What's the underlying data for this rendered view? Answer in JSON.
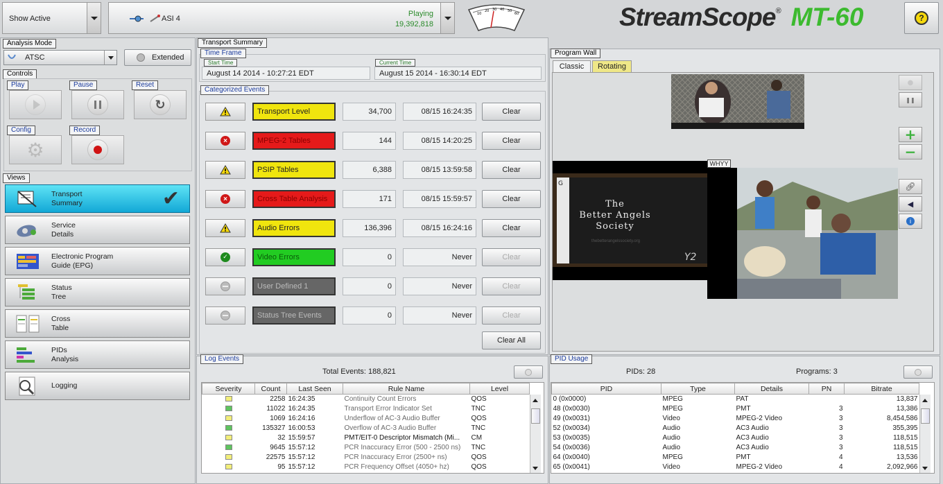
{
  "header": {
    "analysis_dropdown": "Show Active",
    "input_icon": "connector-icon",
    "input_name": "ASI 4",
    "status": "Playing",
    "bitrate": "19,392,818",
    "meter_ticks": [
      "10",
      "20",
      "30",
      "40",
      "50",
      "60"
    ],
    "logo_main": "StreamScope",
    "logo_model": "MT-60",
    "help_icon": "help-icon"
  },
  "analysis_mode": {
    "title": "Analysis Mode",
    "value": "ATSC",
    "extended": "Extended"
  },
  "controls": {
    "title": "Controls",
    "play": "Play",
    "pause": "Pause",
    "reset": "Reset",
    "config": "Config",
    "record": "Record"
  },
  "views": {
    "title": "Views",
    "items": [
      {
        "label": "Transport\nSummary",
        "icon": "transport-icon"
      },
      {
        "label": "Service\nDetails",
        "icon": "service-icon"
      },
      {
        "label": "Electronic Program\nGuide (EPG)",
        "icon": "epg-icon"
      },
      {
        "label": "Status\nTree",
        "icon": "tree-icon"
      },
      {
        "label": "Cross\nTable",
        "icon": "table-icon"
      },
      {
        "label": "PIDs\nAnalysis",
        "icon": "pids-icon"
      },
      {
        "label": "Logging",
        "icon": "logging-icon"
      }
    ]
  },
  "transport_summary": {
    "title": "Transport Summary",
    "time_frame": "Time Frame",
    "start_label": "Start Time",
    "start_value": "August 14 2014 - 10:27:21 EDT",
    "current_label": "Current Time",
    "current_value": "August 15 2014 - 16:30:14 EDT",
    "categorized_title": "Categorized Events",
    "clear_all": "Clear All",
    "events": [
      {
        "status": "warning",
        "label": "Transport Level",
        "color": "#f0e50e",
        "text": "#222",
        "count": "34,700",
        "time": "08/15 16:24:35",
        "clear": "Clear"
      },
      {
        "status": "error",
        "label": "MPEG-2 Tables",
        "color": "#e51a1a",
        "text": "#8a0000",
        "count": "144",
        "time": "08/15 14:20:25",
        "clear": "Clear"
      },
      {
        "status": "warning",
        "label": "PSIP Tables",
        "color": "#f0e50e",
        "text": "#222",
        "count": "6,388",
        "time": "08/15 13:59:58",
        "clear": "Clear"
      },
      {
        "status": "error",
        "label": "Cross Table Analysis",
        "color": "#e51a1a",
        "text": "#8a0000",
        "count": "171",
        "time": "08/15 15:59:57",
        "clear": "Clear"
      },
      {
        "status": "warning",
        "label": "Audio Errors",
        "color": "#f0e50e",
        "text": "#222",
        "count": "136,396",
        "time": "08/15 16:24:16",
        "clear": "Clear"
      },
      {
        "status": "ok",
        "label": "Video Errors",
        "color": "#22cc22",
        "text": "#0a5a0a",
        "count": "0",
        "time": "Never",
        "clear": "Clear"
      },
      {
        "status": "disabled",
        "label": "User Defined 1",
        "color": "#666666",
        "text": "#bbbbbb",
        "count": "0",
        "time": "Never",
        "clear": "Clear"
      },
      {
        "status": "disabled",
        "label": "Status Tree Events",
        "color": "#666666",
        "text": "#bbbbbb",
        "count": "0",
        "time": "Never",
        "clear": "Clear"
      }
    ]
  },
  "program_wall": {
    "title": "Program Wall",
    "tabs": [
      "Classic",
      "Rotating"
    ],
    "channel_tag": "WHYY",
    "slide_text": "The\nBetter Angels\nSociety",
    "slide_url": "thebetterangelssociety.org"
  },
  "log_events": {
    "title": "Log Events",
    "total": "Total Events: 188,821",
    "columns": [
      "Severity",
      "Count",
      "Last Seen",
      "Rule Name",
      "Level"
    ],
    "rows": [
      {
        "sev": "#f2ee7a",
        "count": "2258",
        "seen": "16:24:35",
        "rule": "Continuity Count Errors",
        "level": "QOS",
        "bold": false
      },
      {
        "sev": "#5fc45f",
        "count": "11022",
        "seen": "16:24:35",
        "rule": "Transport Error Indicator Set",
        "level": "TNC",
        "bold": false
      },
      {
        "sev": "#f2ee7a",
        "count": "1069",
        "seen": "16:24:16",
        "rule": "Underflow of AC-3 Audio Buffer",
        "level": "QOS",
        "bold": false
      },
      {
        "sev": "#5fc45f",
        "count": "135327",
        "seen": "16:00:53",
        "rule": "Overflow of AC-3 Audio Buffer",
        "level": "TNC",
        "bold": false
      },
      {
        "sev": "#f2ee7a",
        "count": "32",
        "seen": "15:59:57",
        "rule": "PMT/EIT-0 Descriptor Mismatch (Mi...",
        "level": "CM",
        "bold": true
      },
      {
        "sev": "#5fc45f",
        "count": "9645",
        "seen": "15:57:12",
        "rule": "PCR Inaccuracy Error (500 - 2500 ns)",
        "level": "TNC",
        "bold": false
      },
      {
        "sev": "#f2ee7a",
        "count": "22575",
        "seen": "15:57:12",
        "rule": "PCR Inaccuracy Error (2500+ ns)",
        "level": "QOS",
        "bold": false
      },
      {
        "sev": "#f2ee7a",
        "count": "95",
        "seen": "15:57:12",
        "rule": "PCR Frequency Offset (4050+ hz)",
        "level": "QOS",
        "bold": false
      }
    ]
  },
  "pid_usage": {
    "title": "PID Usage",
    "pids": "PIDs: 28",
    "programs": "Programs: 3",
    "columns": [
      "PID",
      "Type",
      "Details",
      "PN",
      "Bitrate"
    ],
    "rows": [
      {
        "pid": "0 (0x0000)",
        "type": "MPEG",
        "details": "PAT",
        "pn": "",
        "bitrate": "13,837"
      },
      {
        "pid": "48 (0x0030)",
        "type": "MPEG",
        "details": "PMT",
        "pn": "3",
        "bitrate": "13,386"
      },
      {
        "pid": "49 (0x0031)",
        "type": "Video",
        "details": "MPEG-2 Video",
        "pn": "3",
        "bitrate": "8,454,586"
      },
      {
        "pid": "52 (0x0034)",
        "type": "Audio",
        "details": "AC3  Audio",
        "pn": "3",
        "bitrate": "355,395"
      },
      {
        "pid": "53 (0x0035)",
        "type": "Audio",
        "details": "AC3  Audio",
        "pn": "3",
        "bitrate": "118,515"
      },
      {
        "pid": "54 (0x0036)",
        "type": "Audio",
        "details": "AC3  Audio",
        "pn": "3",
        "bitrate": "118,515"
      },
      {
        "pid": "64 (0x0040)",
        "type": "MPEG",
        "details": "PMT",
        "pn": "4",
        "bitrate": "13,536"
      },
      {
        "pid": "65 (0x0041)",
        "type": "Video",
        "details": "MPEG-2 Video",
        "pn": "4",
        "bitrate": "2,092,966"
      }
    ]
  }
}
